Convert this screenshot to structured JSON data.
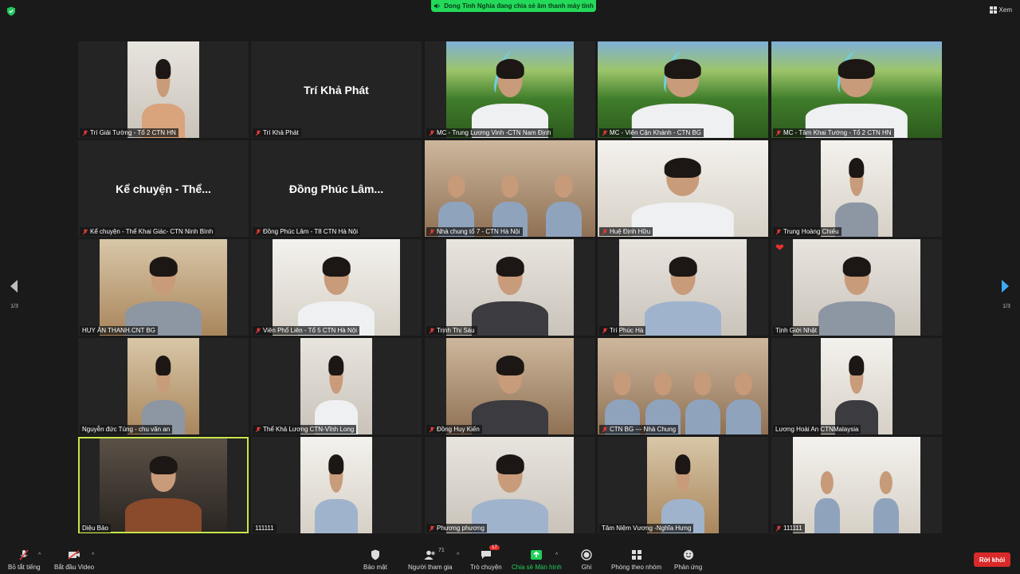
{
  "top": {
    "share_banner": "Dong Tinh Nghia đang chia sẻ âm thanh máy tính",
    "view_label": "Xem"
  },
  "nav": {
    "left_page": "1/3",
    "right_page": "1/3"
  },
  "tiles": [
    {
      "label": "Trí Giải Tường  - Tổ 2 CTN HN",
      "muted": true
    },
    {
      "label": "Trí Khả Phát",
      "muted": true,
      "name_display": "Trí Khả Phát"
    },
    {
      "label": "MC - Trung Lương Vinh -CTN Nam Định",
      "muted": true
    },
    {
      "label": "MC - Viên Cận Khánh - CTN BG",
      "muted": true
    },
    {
      "label": "MC - Tâm Khai Tường - Tổ 2 CTN HN",
      "muted": true
    },
    {
      "label": "Kể chuyện - Thể Khai Giác- CTN Ninh Bình",
      "muted": true,
      "name_display": "Kể chuyện - Thể..."
    },
    {
      "label": "Đồng Phúc Lâm - T8 CTN Hà Nội",
      "muted": true,
      "name_display": "Đồng Phúc Lâm..."
    },
    {
      "label": "Nhà chung tổ 7 - CTN Hà Nội",
      "muted": true
    },
    {
      "label": "Huệ Định Hữu",
      "muted": true
    },
    {
      "label": "Trung Hoàng Chiếu",
      "muted": true
    },
    {
      "label": "HUY ÂN THANH.CNT BG",
      "muted": false
    },
    {
      "label": "Viên Phổ Liên - Tổ 5 CTN Hà Nội",
      "muted": true
    },
    {
      "label": "Trịnh Thị Sáu",
      "muted": true
    },
    {
      "label": "Trí Phúc Hà",
      "muted": true
    },
    {
      "label": "Tịnh Giới Nhật",
      "muted": false,
      "reaction": "❤"
    },
    {
      "label": "Nguyễn đức Tùng - chu văn an",
      "muted": false
    },
    {
      "label": "Thể Khả Lương CTN-Vĩnh Long",
      "muted": true
    },
    {
      "label": "Đồng Huy Kiến",
      "muted": true
    },
    {
      "label": "CTN BG --- Nhà Chung",
      "muted": true
    },
    {
      "label": "Lương Hoài An CTNMalaysia",
      "muted": false
    },
    {
      "label": "Diệu Bảo",
      "muted": false
    },
    {
      "label": "111111",
      "muted": false
    },
    {
      "label": "Phương phương",
      "muted": true
    },
    {
      "label": "Tâm Niệm Vương -Nghĩa Hưng",
      "muted": false
    },
    {
      "label": "111111",
      "muted": true
    }
  ],
  "toolbar": {
    "mute": "Bỏ tắt tiếng",
    "video": "Bắt đầu Video",
    "security": "Bảo mật",
    "participants": "Người tham gia",
    "participants_count": "71",
    "chat": "Trò chuyện",
    "chat_badge": "17",
    "share": "Chia sẻ Màn hình",
    "record": "Ghi",
    "breakout": "Phòng theo nhóm",
    "reactions": "Phản ứng",
    "leave": "Rời khỏi"
  },
  "colors": {
    "share_green": "#23d959",
    "active_speaker": "#c6e64a",
    "leave_red": "#d82a2a",
    "nav_arrow": "#3fa9f5"
  }
}
